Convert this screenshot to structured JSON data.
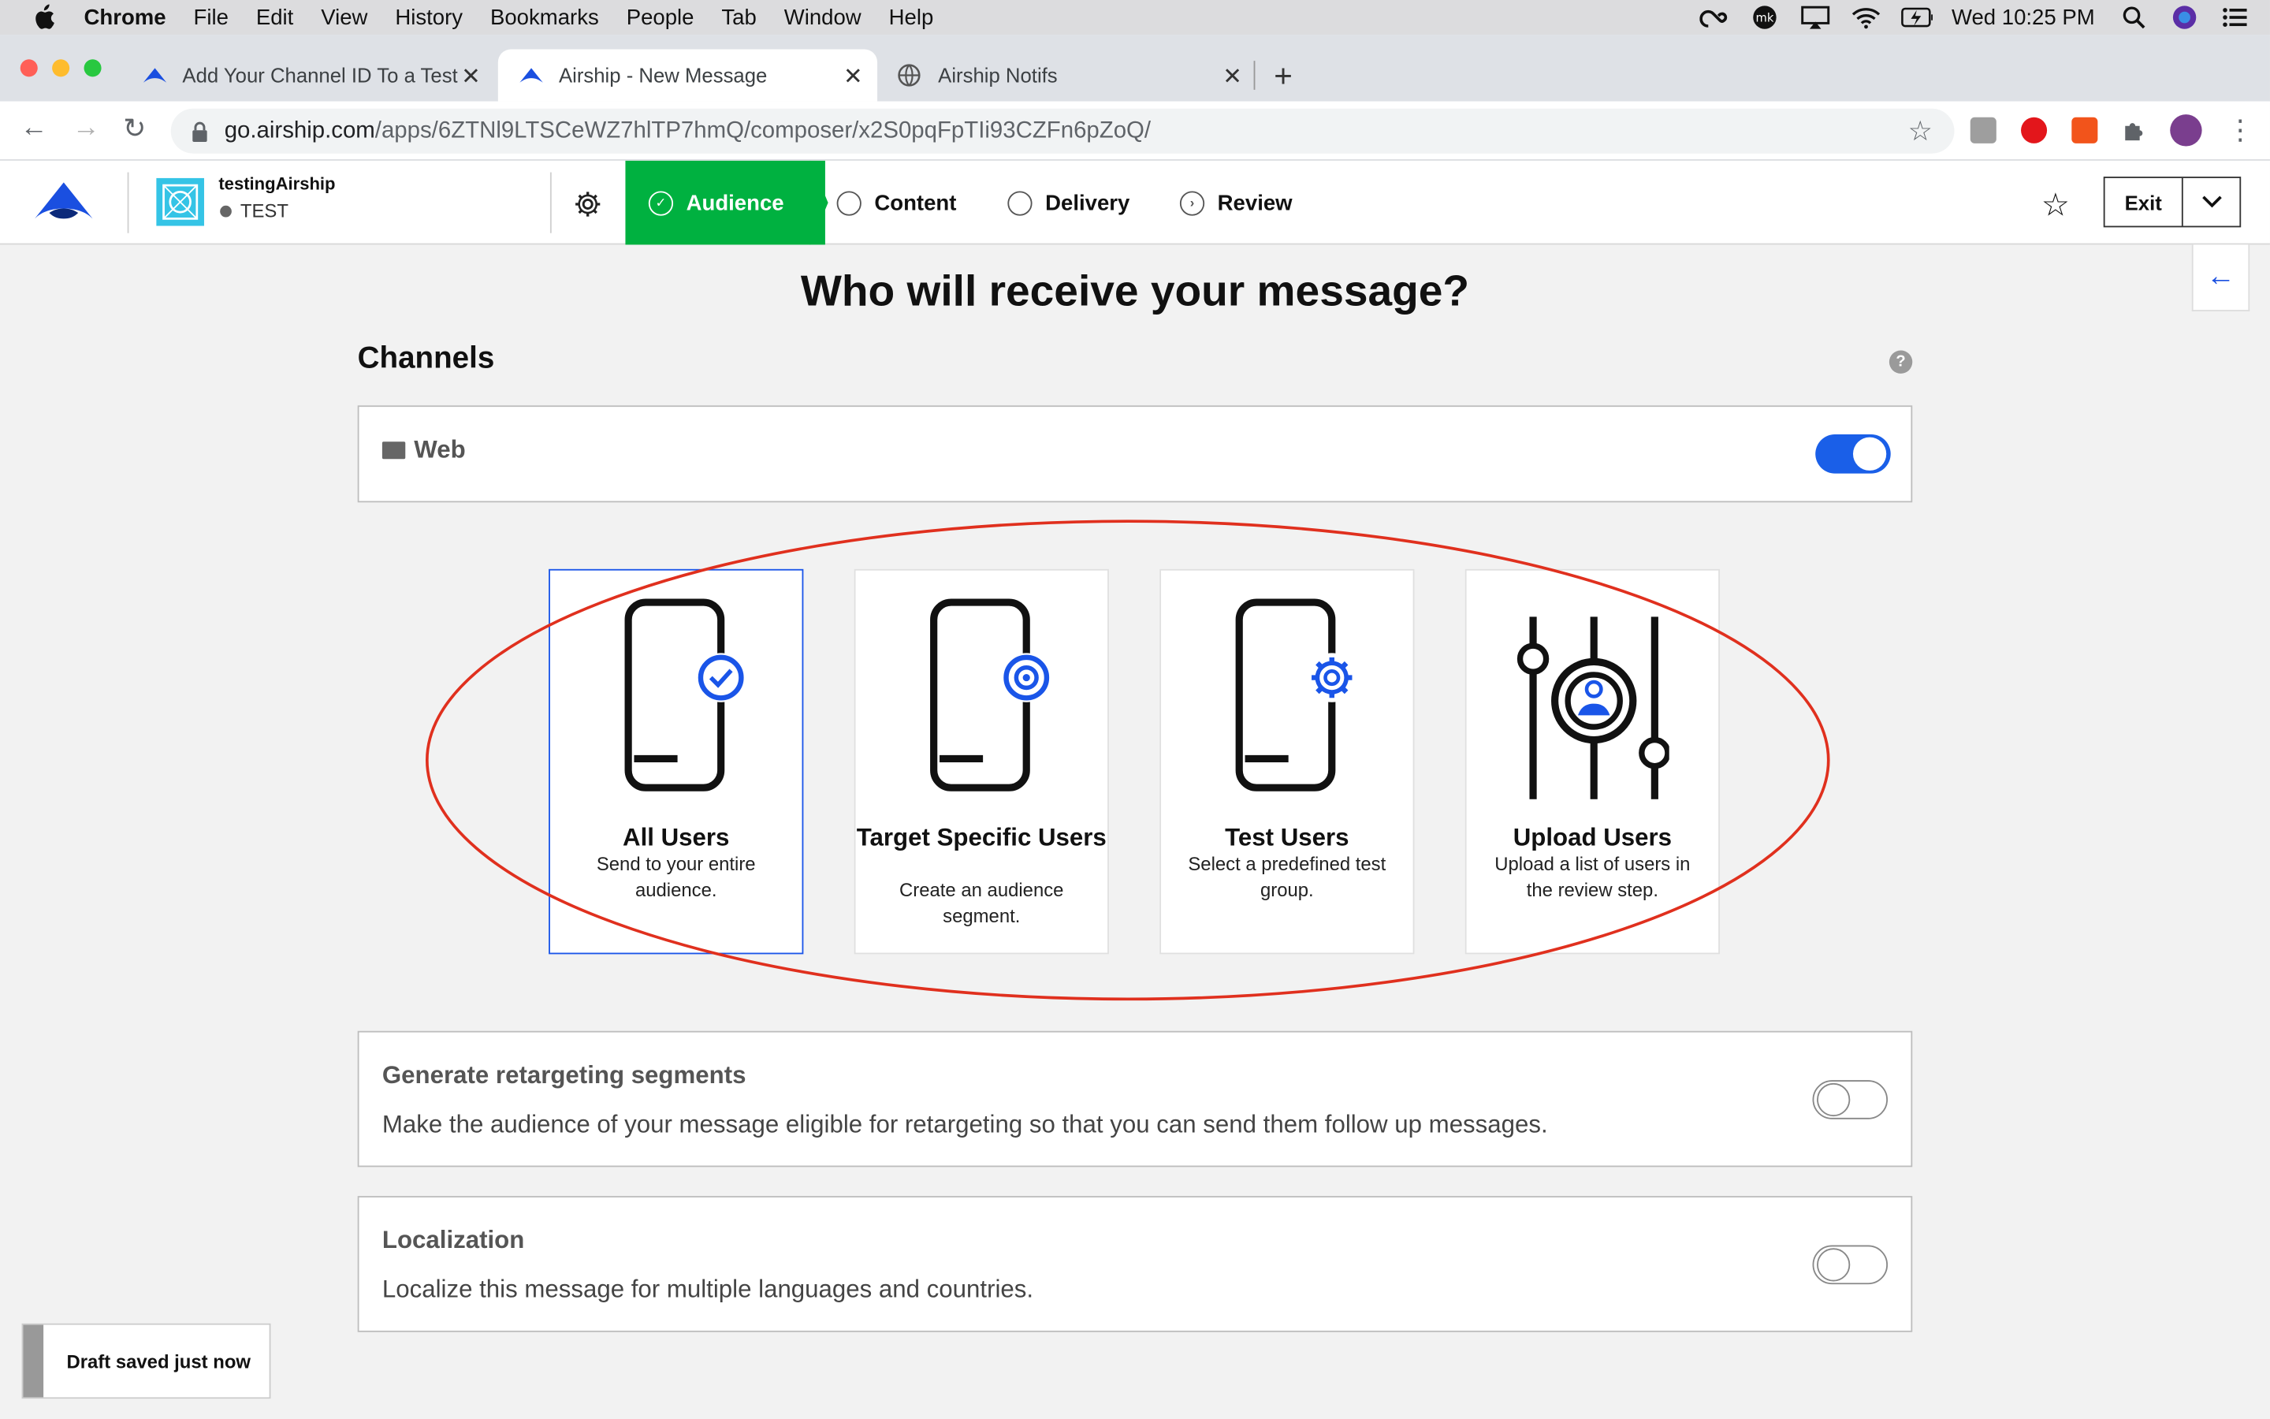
{
  "menubar": {
    "app": "Chrome",
    "items": [
      "File",
      "Edit",
      "View",
      "History",
      "Bookmarks",
      "People",
      "Tab",
      "Window",
      "Help"
    ],
    "clock": "Wed 10:25 PM"
  },
  "browser": {
    "tabs": [
      {
        "title": "Add Your Channel ID To a Test (",
        "favicon": "airship-icon",
        "active": false
      },
      {
        "title": "Airship - New Message",
        "favicon": "airship-icon",
        "active": true
      },
      {
        "title": "Airship Notifs",
        "favicon": "globe-icon",
        "active": false
      }
    ],
    "url_host": "go.airship.com",
    "url_path": "/apps/6ZTNl9LTSCeWZ7hlTP7hmQ/composer/x2S0pqFpTIi93CZFn6pZoQ/"
  },
  "app": {
    "project_name": "testingAirship",
    "project_env": "TEST",
    "steps": [
      {
        "label": "Audience",
        "state": "active"
      },
      {
        "label": "Content",
        "state": "pending"
      },
      {
        "label": "Delivery",
        "state": "pending"
      },
      {
        "label": "Review",
        "state": "pending"
      }
    ],
    "exit_label": "Exit",
    "accent_color": "#00b140",
    "brand_blue": "#1a55e8"
  },
  "main": {
    "heading": "Who will receive your message?",
    "channels_label": "Channels",
    "help_glyph": "?",
    "channel": {
      "label": "Web",
      "enabled": true
    },
    "audience_cards": [
      {
        "title": "All Users",
        "description": "Send to your entire audience.",
        "icon": "phone-check-icon",
        "selected": true
      },
      {
        "title": "Target Specific Users",
        "description": "Create an audience segment.",
        "icon": "phone-target-icon",
        "selected": false
      },
      {
        "title": "Test Users",
        "description": "Select a predefined test group.",
        "icon": "phone-gear-icon",
        "selected": false
      },
      {
        "title": "Upload Users",
        "description": "Upload a list of users in the review step.",
        "icon": "sliders-user-icon",
        "selected": false
      }
    ],
    "options": [
      {
        "title": "Generate retargeting segments",
        "description": "Make the audience of your message eligible for retargeting so that you can send them follow up messages.",
        "enabled": false
      },
      {
        "title": "Localization",
        "description": "Localize this message for multiple languages and countries.",
        "enabled": false
      }
    ],
    "annotation_color": "#e0301e"
  },
  "toast": {
    "text": "Draft saved just now"
  }
}
